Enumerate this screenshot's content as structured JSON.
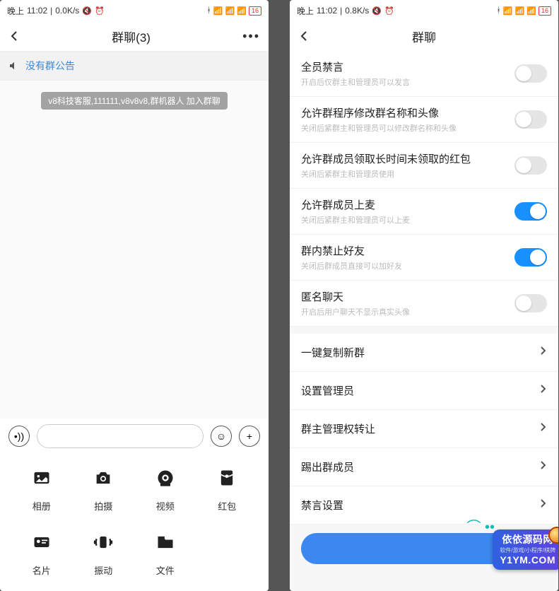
{
  "status": {
    "time_prefix": "晚上",
    "time": "11:02",
    "speed1": "0.0K/s",
    "speed2": "0.8K/s",
    "battery": "16"
  },
  "phone1": {
    "title": "群聊(3)",
    "announce": "没有群公告",
    "sys_msg": "v8科技客服,111111,v8v8v8,群机器人 加入群聊",
    "grid": [
      {
        "label": "相册",
        "icon": "photo"
      },
      {
        "label": "拍摄",
        "icon": "camera"
      },
      {
        "label": "视频",
        "icon": "video"
      },
      {
        "label": "红包",
        "icon": "redpacket"
      },
      {
        "label": "名片",
        "icon": "card"
      },
      {
        "label": "振动",
        "icon": "vibrate"
      },
      {
        "label": "文件",
        "icon": "file"
      }
    ]
  },
  "phone2": {
    "title": "群聊",
    "settings": [
      {
        "title": "全员禁言",
        "desc": "开启后仅群主和管理员可以发言",
        "on": false
      },
      {
        "title": "允许群程序修改群名称和头像",
        "desc": "关闭后紧群主和管理员可以修改群名称和头像",
        "on": false
      },
      {
        "title": "允许群成员领取长时间未领取的红包",
        "desc": "关闭后紧群主和管理员使用",
        "on": false
      },
      {
        "title": "允许群成员上麦",
        "desc": "关闭后紧群主和管理员可以上麦",
        "on": true
      },
      {
        "title": "群内禁止好友",
        "desc": "关闭后群成员直接可以加好友",
        "on": true
      },
      {
        "title": "匿名聊天",
        "desc": "开启后用户聊天不显示真实头像",
        "on": false
      }
    ],
    "links": [
      "一键复制新群",
      "设置管理员",
      "群主管理权转让",
      "踢出群成员",
      "禁言设置"
    ]
  },
  "watermark": {
    "small": "软件/游戏/小程序/棋牌",
    "big": "依依源码网",
    "url": "Y1YM.COM"
  }
}
